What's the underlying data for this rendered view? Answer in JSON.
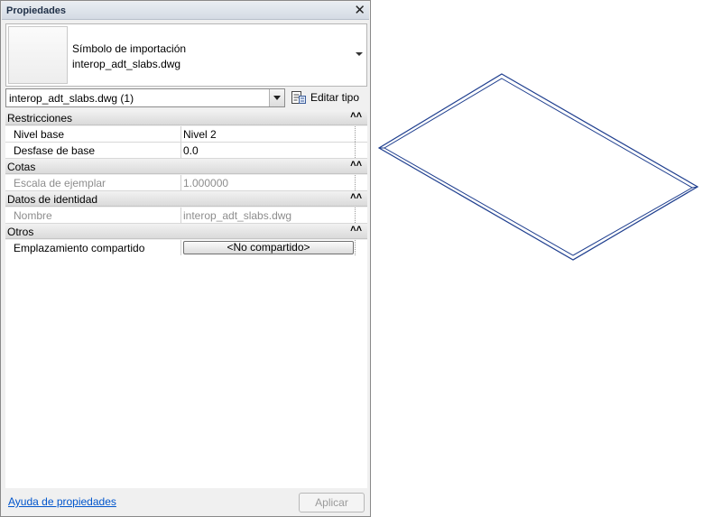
{
  "palette": {
    "title": "Propiedades",
    "type_family": "Símbolo de importación",
    "type_name": "interop_adt_slabs.dwg",
    "selector_value": "interop_adt_slabs.dwg (1)",
    "edit_type_label": "Editar tipo"
  },
  "groups": [
    {
      "label": "Restricciones",
      "rows": [
        {
          "name": "Nivel base",
          "value": "Nivel 2"
        },
        {
          "name": "Desfase de base",
          "value": "0.0"
        }
      ]
    },
    {
      "label": "Cotas",
      "rows": [
        {
          "name": "Escala de ejemplar",
          "value": "1.000000"
        }
      ]
    },
    {
      "label": "Datos de identidad",
      "rows": [
        {
          "name": "Nombre",
          "value": "interop_adt_slabs.dwg"
        }
      ]
    },
    {
      "label": "Otros",
      "rows": [
        {
          "name": "Emplazamiento compartido",
          "value": "<No compartido>"
        }
      ]
    }
  ],
  "footer": {
    "help_link": "Ayuda de propiedades",
    "apply_label": "Aplicar"
  },
  "colors": {
    "slab_outline": "#1f3f8f",
    "link": "#0055cc"
  },
  "icons": {
    "close": "close-icon",
    "edit_type": "edit-type-icon",
    "collapse": "collapse-chevrons-icon"
  }
}
